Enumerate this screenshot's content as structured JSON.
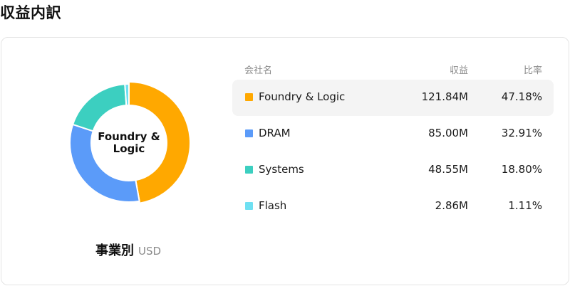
{
  "page": {
    "title": "収益内訳"
  },
  "chart": {
    "center_label": "Foundry & Logic",
    "caption": "事業別",
    "unit": "USD"
  },
  "table": {
    "headers": {
      "name": "会社名",
      "value": "収益",
      "ratio": "比率"
    },
    "active_row": 0
  },
  "chart_data": {
    "type": "pie",
    "donut": true,
    "categories": [
      "Foundry & Logic",
      "DRAM",
      "Systems",
      "Flash"
    ],
    "values": [
      121.84,
      85.0,
      48.55,
      2.86
    ],
    "value_labels": [
      "121.84M",
      "85.00M",
      "48.55M",
      "2.86M"
    ],
    "percent_labels": [
      "47.18%",
      "32.91%",
      "18.80%",
      "1.11%"
    ],
    "colors": [
      "#ffa800",
      "#5b9bf9",
      "#3ccfc0",
      "#6fe0f2"
    ],
    "legend": "right"
  }
}
